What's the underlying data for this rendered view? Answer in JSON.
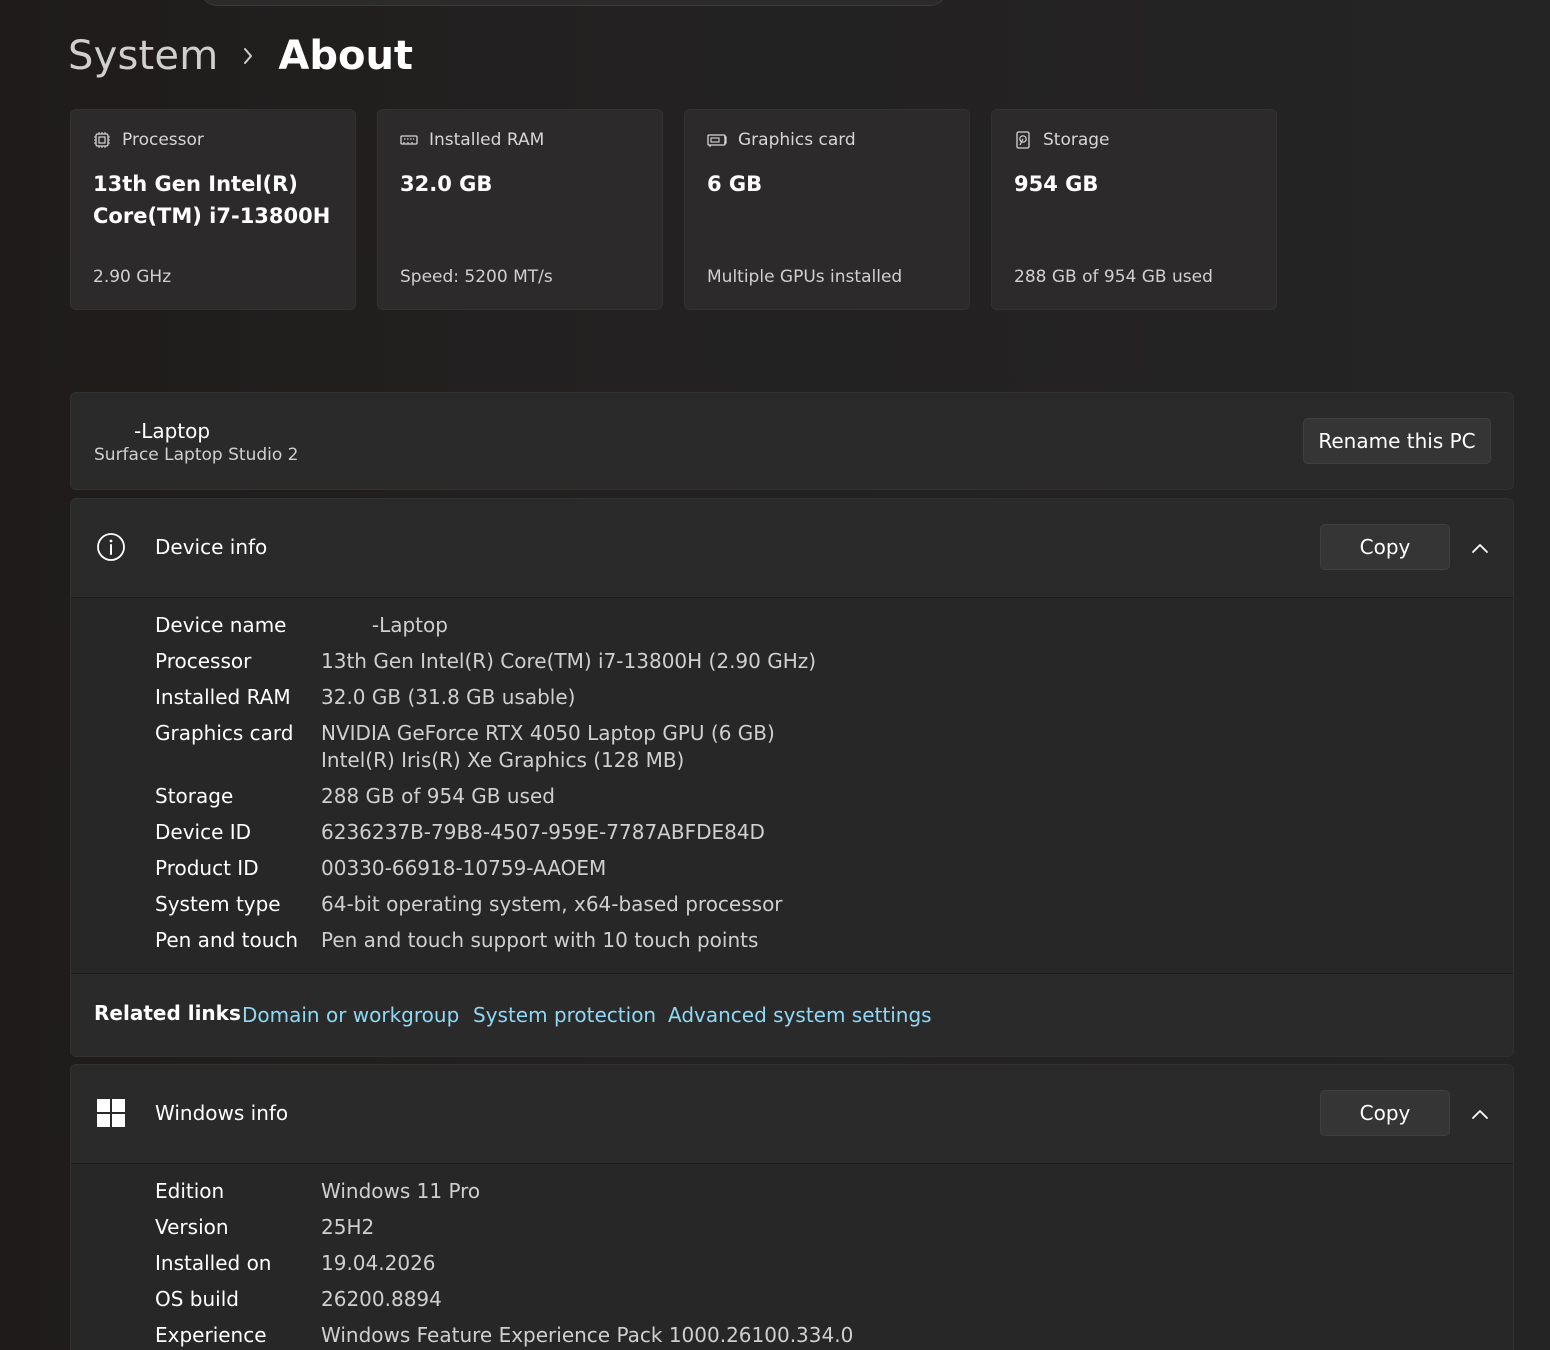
{
  "breadcrumb": {
    "parent": "System",
    "current": "About"
  },
  "spec_cards": [
    {
      "icon": "processor-icon",
      "title": "Processor",
      "value": "13th Gen Intel(R)\nCore(TM) i7-13800H",
      "sub": "2.90 GHz"
    },
    {
      "icon": "ram-icon",
      "title": "Installed RAM",
      "value": "32.0 GB",
      "sub": "Speed: 5200 MT/s"
    },
    {
      "icon": "graphics-card-icon",
      "title": "Graphics card",
      "value": "6 GB",
      "sub": "Multiple GPUs installed"
    },
    {
      "icon": "storage-icon",
      "title": "Storage",
      "value": "954 GB",
      "sub": "288 GB of 954 GB used"
    }
  ],
  "pc": {
    "name": "-Laptop",
    "model": "Surface Laptop Studio 2",
    "rename_label": "Rename this PC"
  },
  "device_info": {
    "icon": "info-icon",
    "title": "Device info",
    "copy_label": "Copy",
    "rows": [
      {
        "label": "Device name",
        "value": "        -Laptop"
      },
      {
        "label": "Processor",
        "value": "13th Gen Intel(R) Core(TM) i7-13800H (2.90 GHz)"
      },
      {
        "label": "Installed RAM",
        "value": "32.0 GB (31.8 GB usable)"
      },
      {
        "label": "Graphics card",
        "value": "NVIDIA GeForce RTX 4050 Laptop GPU (6 GB)\nIntel(R) Iris(R) Xe Graphics (128 MB)"
      },
      {
        "label": "Storage",
        "value": "288 GB of 954 GB used"
      },
      {
        "label": "Device ID",
        "value": "6236237B-79B8-4507-959E-7787ABFDE84D"
      },
      {
        "label": "Product ID",
        "value": "00330-66918-10759-AAOEM"
      },
      {
        "label": "System type",
        "value": "64-bit operating system, x64-based processor"
      },
      {
        "label": "Pen and touch",
        "value": "Pen and touch support with 10 touch points"
      }
    ]
  },
  "related_links": {
    "label": "Related links",
    "links": [
      "Domain or workgroup",
      "System protection",
      "Advanced system settings"
    ]
  },
  "windows_info": {
    "icon": "windows-logo-icon",
    "title": "Windows info",
    "copy_label": "Copy",
    "rows": [
      {
        "label": "Edition",
        "value": "Windows 11 Pro"
      },
      {
        "label": "Version",
        "value": "25H2"
      },
      {
        "label": "Installed on",
        "value": "19.04.2026"
      },
      {
        "label": "OS build",
        "value": "26200.8894"
      },
      {
        "label": "Experience",
        "value": "Windows Feature Experience Pack 1000.26100.334.0"
      }
    ]
  },
  "colors": {
    "link": "#8fd8f5",
    "card_bg": "#2c2a2a",
    "panel_bg": "#2b2a2a"
  }
}
